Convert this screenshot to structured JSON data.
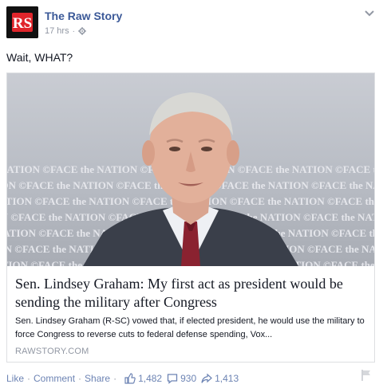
{
  "post": {
    "page_name": "The Raw Story",
    "timestamp": "17 hrs",
    "status_text": "Wait, WHAT?"
  },
  "card": {
    "title": "Sen. Lindsey Graham: My first act as president would be sending the military after Congress",
    "description": "Sen. Lindsey Graham (R-SC) vowed that, if elected president, he would use the military to force Congress to reverse cuts to federal defense spending, Vox...",
    "source": "RAWSTORY.COM",
    "watermark": "NATION ©FACE the NATION ©FACE the NATION ©FACE the NATION ©FACE the NATION"
  },
  "actions": {
    "like_label": "Like",
    "comment_label": "Comment",
    "share_label": "Share",
    "separator": "·",
    "likes_count": "1,482",
    "comments_count": "930",
    "shares_count": "1,413"
  },
  "icons": {
    "avatar": "raw-story-logo-icon",
    "audience": "gear-icon",
    "menu": "chevron-down-icon",
    "likes": "thumbs-up-icon",
    "comments": "comment-bubble-icon",
    "shares": "share-arrow-icon",
    "flag": "flag-icon"
  },
  "colors": {
    "link_blue": "#3b5998",
    "muted_blue": "#6d84b4",
    "meta_gray": "#9197a3",
    "border": "#dddfe2",
    "logo_red": "#e0252b"
  }
}
